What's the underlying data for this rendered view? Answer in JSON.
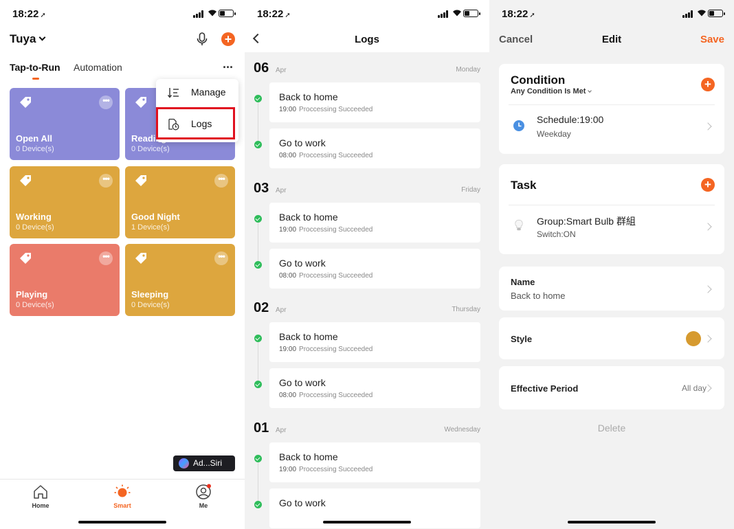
{
  "colors": {
    "accent": "#f46522",
    "success": "#2fbd5b",
    "highlight": "#e0101f",
    "style_swatch": "#d69a2f"
  },
  "status_bar": {
    "time": "18:22",
    "location_icon": "location-arrow-icon"
  },
  "smart_screen": {
    "home_name": "Tuya",
    "tabs": [
      {
        "label": "Tap-to-Run",
        "active": true
      },
      {
        "label": "Automation",
        "active": false
      }
    ],
    "more_label": "···",
    "scenes": [
      {
        "name": "Open All",
        "devices": "0 Device(s)",
        "color": "#8b8ad8"
      },
      {
        "name": "Reading",
        "devices": "0 Device(s)",
        "color": "#8b8ad8"
      },
      {
        "name": "Working",
        "devices": "0 Device(s)",
        "color": "#dda63e"
      },
      {
        "name": "Good Night",
        "devices": "1 Device(s)",
        "color": "#dda63e"
      },
      {
        "name": "Playing",
        "devices": "0 Device(s)",
        "color": "#ea7b6a"
      },
      {
        "name": "Sleeping",
        "devices": "0 Device(s)",
        "color": "#dda63e"
      }
    ],
    "scene_more": "•••",
    "menu": [
      {
        "label": "Manage",
        "icon": "sort-list-icon"
      },
      {
        "label": "Logs",
        "icon": "log-clock-icon"
      }
    ],
    "siri_badge": "Ad...Siri",
    "tabbar": [
      {
        "label": "Home",
        "icon": "home-icon",
        "active": false
      },
      {
        "label": "Smart",
        "icon": "sun-icon",
        "active": true
      },
      {
        "label": "Me",
        "icon": "profile-icon",
        "active": false
      }
    ]
  },
  "logs_screen": {
    "title": "Logs",
    "days": [
      {
        "day": "06",
        "month": "Apr",
        "weekday": "Monday",
        "entries": [
          {
            "title": "Back to home",
            "time": "19:00",
            "status": "Proccessing Succeeded"
          },
          {
            "title": "Go to work",
            "time": "08:00",
            "status": "Proccessing Succeeded"
          }
        ]
      },
      {
        "day": "03",
        "month": "Apr",
        "weekday": "Friday",
        "entries": [
          {
            "title": "Back to home",
            "time": "19:00",
            "status": "Proccessing Succeeded"
          },
          {
            "title": "Go to work",
            "time": "08:00",
            "status": "Proccessing Succeeded"
          }
        ]
      },
      {
        "day": "02",
        "month": "Apr",
        "weekday": "Thursday",
        "entries": [
          {
            "title": "Back to home",
            "time": "19:00",
            "status": "Proccessing Succeeded"
          },
          {
            "title": "Go to work",
            "time": "08:00",
            "status": "Proccessing Succeeded"
          }
        ]
      },
      {
        "day": "01",
        "month": "Apr",
        "weekday": "Wednesday",
        "entries": [
          {
            "title": "Back to home",
            "time": "19:00",
            "status": "Proccessing Succeeded"
          },
          {
            "title": "Go to work",
            "time": "",
            "status": ""
          }
        ]
      }
    ]
  },
  "edit_screen": {
    "cancel": "Cancel",
    "title": "Edit",
    "save": "Save",
    "condition": {
      "title": "Condition",
      "subtitle": "Any Condition Is Met",
      "item_title": "Schedule:19:00",
      "item_sub": "Weekday",
      "item_icon": "clock-icon"
    },
    "task": {
      "title": "Task",
      "item_title": "Group:Smart Bulb 群組",
      "item_sub": "Switch:ON",
      "item_icon": "bulb-icon"
    },
    "name": {
      "label": "Name",
      "value": "Back to home"
    },
    "style": {
      "label": "Style"
    },
    "period": {
      "label": "Effective Period",
      "value": "All day"
    },
    "delete": "Delete"
  }
}
